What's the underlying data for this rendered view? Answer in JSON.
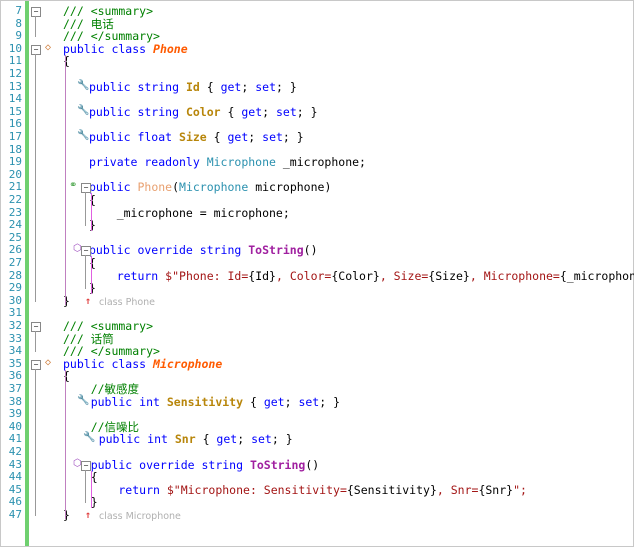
{
  "lines": [
    {
      "n": "7",
      "t": [
        [
          "cm",
          "/// <summary>"
        ]
      ]
    },
    {
      "n": "8",
      "t": [
        [
          "cm",
          "/// 电话"
        ]
      ]
    },
    {
      "n": "9",
      "t": [
        [
          "cm",
          "/// </summary>"
        ]
      ]
    },
    {
      "n": "10",
      "t": [
        [
          "kw",
          "public class "
        ],
        [
          "cls",
          "Phone"
        ]
      ]
    },
    {
      "n": "11",
      "t": [
        [
          "",
          "{"
        ]
      ]
    },
    {
      "n": "12",
      "t": []
    },
    {
      "n": "13",
      "t": [
        [
          "kw",
          "public string "
        ],
        [
          "pr",
          "Id"
        ],
        [
          "",
          " { "
        ],
        [
          "kw",
          "get"
        ],
        [
          "",
          "; "
        ],
        [
          "kw",
          "set"
        ],
        [
          "",
          "; }"
        ]
      ]
    },
    {
      "n": "14",
      "t": []
    },
    {
      "n": "15",
      "t": [
        [
          "kw",
          "public string "
        ],
        [
          "pr",
          "Color"
        ],
        [
          "",
          " { "
        ],
        [
          "kw",
          "get"
        ],
        [
          "",
          "; "
        ],
        [
          "kw",
          "set"
        ],
        [
          "",
          "; }"
        ]
      ]
    },
    {
      "n": "16",
      "t": []
    },
    {
      "n": "17",
      "t": [
        [
          "kw",
          "public float "
        ],
        [
          "pr",
          "Size"
        ],
        [
          "",
          " { "
        ],
        [
          "kw",
          "get"
        ],
        [
          "",
          "; "
        ],
        [
          "kw",
          "set"
        ],
        [
          "",
          "; }"
        ]
      ]
    },
    {
      "n": "18",
      "t": []
    },
    {
      "n": "19",
      "t": [
        [
          "kw",
          "private readonly "
        ],
        [
          "ty",
          "Microphone"
        ],
        [
          "",
          " _microphone;"
        ]
      ]
    },
    {
      "n": "20",
      "t": []
    },
    {
      "n": "21",
      "t": [
        [
          "kw",
          "public "
        ],
        [
          "ctor",
          "Phone"
        ],
        [
          "",
          "("
        ],
        [
          "ty",
          "Microphone"
        ],
        [
          "",
          " microphone)"
        ]
      ]
    },
    {
      "n": "22",
      "t": [
        [
          "",
          "{"
        ]
      ]
    },
    {
      "n": "23",
      "t": [
        [
          "",
          "    _microphone = microphone;"
        ]
      ]
    },
    {
      "n": "24",
      "t": [
        [
          "",
          "}"
        ]
      ]
    },
    {
      "n": "25",
      "t": []
    },
    {
      "n": "26",
      "t": [
        [
          "kw",
          "public override string "
        ],
        [
          "meth",
          "ToString"
        ],
        [
          "",
          "()"
        ]
      ]
    },
    {
      "n": "27",
      "t": [
        [
          "",
          "{"
        ]
      ]
    },
    {
      "n": "28",
      "t": [
        [
          "kw",
          "    return "
        ],
        [
          "st",
          "$\"Phone: Id="
        ],
        [
          "",
          "{Id}"
        ],
        [
          "st",
          ", Color="
        ],
        [
          "",
          "{Color}"
        ],
        [
          "st",
          ", Size="
        ],
        [
          "",
          "{Size}"
        ],
        [
          "st",
          ", Microphone="
        ],
        [
          "",
          "{_microphone}"
        ],
        [
          "st",
          "\";"
        ]
      ]
    },
    {
      "n": "29",
      "t": [
        [
          "",
          "}"
        ]
      ]
    },
    {
      "n": "30",
      "t": [
        [
          "",
          "}"
        ]
      ]
    },
    {
      "n": "31",
      "t": []
    },
    {
      "n": "32",
      "t": [
        [
          "cm",
          "/// <summary>"
        ]
      ]
    },
    {
      "n": "33",
      "t": [
        [
          "cm",
          "/// 话筒"
        ]
      ]
    },
    {
      "n": "34",
      "t": [
        [
          "cm",
          "/// </summary>"
        ]
      ]
    },
    {
      "n": "35",
      "t": [
        [
          "kw",
          "public class "
        ],
        [
          "cls",
          "Microphone"
        ]
      ]
    },
    {
      "n": "36",
      "t": [
        [
          "",
          "{"
        ]
      ]
    },
    {
      "n": "37",
      "t": [
        [
          "cm",
          "    //敏感度"
        ]
      ]
    },
    {
      "n": "38",
      "t": [
        [
          "kw",
          "    public int "
        ],
        [
          "pr",
          "Sensitivity"
        ],
        [
          "",
          " { "
        ],
        [
          "kw",
          "get"
        ],
        [
          "",
          "; "
        ],
        [
          "kw",
          "set"
        ],
        [
          "",
          "; }"
        ]
      ]
    },
    {
      "n": "39",
      "t": []
    },
    {
      "n": "40",
      "t": [
        [
          "cm",
          "    //信噪比"
        ]
      ]
    },
    {
      "n": "41",
      "t": [
        [
          "kw",
          "    public int "
        ],
        [
          "pr",
          "Snr"
        ],
        [
          "",
          " { "
        ],
        [
          "kw",
          "get"
        ],
        [
          "",
          "; "
        ],
        [
          "kw",
          "set"
        ],
        [
          "",
          "; }"
        ]
      ]
    },
    {
      "n": "42",
      "t": []
    },
    {
      "n": "43",
      "t": [
        [
          "kw",
          "    public override string "
        ],
        [
          "meth",
          "ToString"
        ],
        [
          "",
          "()"
        ]
      ]
    },
    {
      "n": "44",
      "t": [
        [
          "",
          "    {"
        ]
      ]
    },
    {
      "n": "45",
      "t": [
        [
          "kw",
          "        return "
        ],
        [
          "st",
          "$\"Microphone: Sensitivity="
        ],
        [
          "",
          "{Sensitivity}"
        ],
        [
          "st",
          ", Snr="
        ],
        [
          "",
          "{Snr}"
        ],
        [
          "st",
          "\";"
        ]
      ]
    },
    {
      "n": "46",
      "t": [
        [
          "",
          "    }"
        ]
      ]
    },
    {
      "n": "47",
      "t": [
        [
          "",
          "}"
        ]
      ]
    }
  ],
  "hints": {
    "phone_end": "class Phone",
    "microphone_end": "class Microphone"
  },
  "icons": {
    "wrench": "property-wrench-icon",
    "class_glyph": "class-glyph-icon",
    "method_glyph": "method-cube-icon",
    "ctor_glyph": "constructor-glyph-icon",
    "collapse": "collapse-box-icon",
    "up_arrow": "scope-up-arrow-icon"
  },
  "colors": {
    "keyword": "#0000ff",
    "comment": "#008000",
    "string": "#a31515",
    "type": "#2b91af",
    "class_name": "#ff5a00",
    "change_bar": "#6fd06f"
  }
}
